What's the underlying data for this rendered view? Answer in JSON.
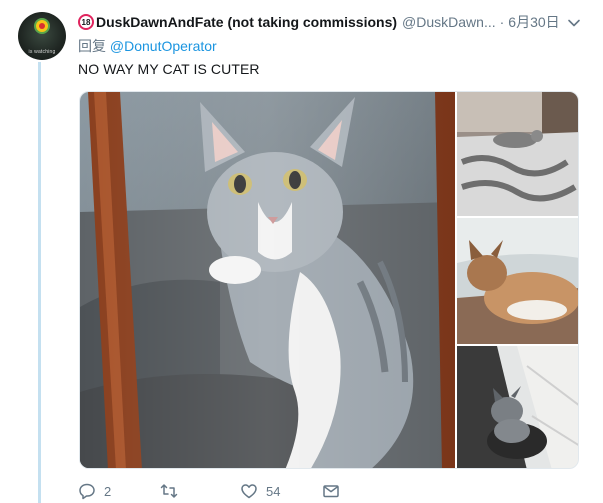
{
  "tweet": {
    "author": {
      "badge": "18",
      "display_name": "DuskDawnAndFate (not taking commissions)",
      "handle": "@DuskDawn...",
      "date": "6月30日",
      "avatar_caption": "is watching"
    },
    "reply": {
      "label": "回复",
      "mention": "@DonutOperator"
    },
    "text": "NO WAY MY CAT IS CUTER",
    "media": {
      "count": 4,
      "items": [
        {
          "icon": "cat-behind-glass-photo"
        },
        {
          "icon": "cat-on-bed-photo"
        },
        {
          "icon": "calico-cat-photo"
        },
        {
          "icon": "cat-in-shoe-photo"
        }
      ]
    },
    "actions": {
      "reply_count": "2",
      "retweet_count": "",
      "like_count": "54"
    }
  },
  "colors": {
    "link": "#1b95e0",
    "secondary_text": "#657786",
    "thread_line": "#c4e0f0",
    "badge_ring": "#e0245e"
  }
}
